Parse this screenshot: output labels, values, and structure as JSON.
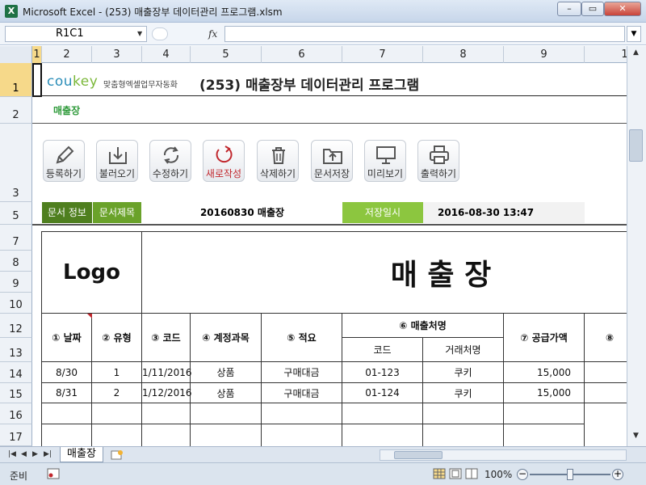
{
  "window": {
    "app_icon": "X",
    "title": "Microsoft Excel - (253) 매출장부 데이터관리 프로그램.xlsm",
    "controls": [
      "–",
      "▭",
      "✕"
    ]
  },
  "formula_bar": {
    "name_box": "R1C1",
    "fx": "fx",
    "formula": ""
  },
  "columns": [
    "1",
    "2",
    "3",
    "4",
    "5",
    "6",
    "7",
    "8",
    "9",
    "1"
  ],
  "rows": [
    "1",
    "2",
    "3",
    "5",
    "7",
    "8",
    "9",
    "10",
    "12",
    "13",
    "14",
    "15",
    "16",
    "17"
  ],
  "header": {
    "brand_main": "cou",
    "brand_accent": "key",
    "brand_sub": "맞춤형엑셀업무자동화",
    "title": "(253) 매출장부 데이터관리 프로그램"
  },
  "section": {
    "label": "매출장"
  },
  "toolbar": [
    {
      "icon": "pencil-icon",
      "label": "등록하기"
    },
    {
      "icon": "download-icon",
      "label": "불러오기"
    },
    {
      "icon": "refresh-icon",
      "label": "수정하기"
    },
    {
      "icon": "new-icon",
      "label": "새로작성"
    },
    {
      "icon": "trash-icon",
      "label": "삭제하기"
    },
    {
      "icon": "folder-icon",
      "label": "문서저장"
    },
    {
      "icon": "monitor-icon",
      "label": "미리보기"
    },
    {
      "icon": "printer-icon",
      "label": "출력하기"
    }
  ],
  "info": {
    "doc_info_label": "문서 정보",
    "doc_title_label": "문서제목",
    "doc_title_value": "20160830 매출장",
    "saved_label": "저장일시",
    "saved_value": "2016-08-30 13:47"
  },
  "ledger": {
    "logo": "Logo",
    "title": "매 출 장",
    "headers": {
      "date": "① 날짜",
      "type": "② 유형",
      "code": "③ 코드",
      "account": "④ 계정과목",
      "summary": "⑤ 적요",
      "customer": "⑥ 매출처명",
      "customer_code": "코드",
      "customer_name": "거래처명",
      "supply": "⑦ 공급가액",
      "col8": "⑧"
    },
    "rows": [
      {
        "date": "8/30",
        "type": "1",
        "code": "1/11/2016",
        "account": "상품",
        "summary": "구매대금",
        "cust_code": "01-123",
        "cust_name": "쿠키",
        "supply": "15,000"
      },
      {
        "date": "8/31",
        "type": "2",
        "code": "1/12/2016",
        "account": "상품",
        "summary": "구매대금",
        "cust_code": "01-124",
        "cust_name": "쿠키",
        "supply": "15,000"
      }
    ]
  },
  "tabs": {
    "sheet": "매출장"
  },
  "status": {
    "ready": "준비",
    "zoom": "100%"
  }
}
